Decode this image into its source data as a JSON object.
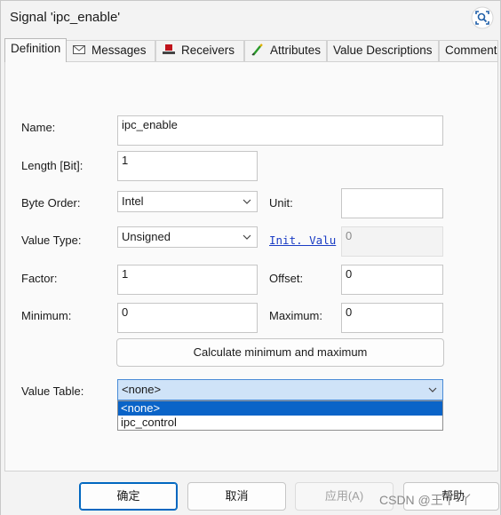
{
  "window": {
    "title": "Signal 'ipc_enable'"
  },
  "tabs": [
    {
      "label": "Definition",
      "icon": "none"
    },
    {
      "label": "Messages",
      "icon": "envelope-icon"
    },
    {
      "label": "Receivers",
      "icon": "receiver-icon"
    },
    {
      "label": "Attributes",
      "icon": "attributes-icon"
    },
    {
      "label": "Value Descriptions",
      "icon": "none"
    },
    {
      "label": "Comment",
      "icon": "none"
    }
  ],
  "form": {
    "name_label": "Name:",
    "name_value": "ipc_enable",
    "length_label": "Length [Bit]:",
    "length_value": "1",
    "byte_order_label": "Byte Order:",
    "byte_order_value": "Intel",
    "unit_label": "Unit:",
    "unit_value": "",
    "value_type_label": "Value Type:",
    "value_type_value": "Unsigned",
    "init_value_link": "Init. Valu",
    "init_value_value": "0",
    "factor_label": "Factor:",
    "factor_value": "1",
    "offset_label": "Offset:",
    "offset_value": "0",
    "minimum_label": "Minimum:",
    "minimum_value": "0",
    "maximum_label": "Maximum:",
    "maximum_value": "0",
    "calc_button": "Calculate minimum and maximum",
    "value_table_label": "Value Table:",
    "value_table_value": "<none>",
    "value_table_options": [
      "<none>",
      "ipc_control"
    ]
  },
  "footer": {
    "ok": "确定",
    "cancel": "取消",
    "apply": "应用(A)",
    "help": "帮助"
  },
  "watermark": "CSDN @王丫-丫",
  "colors": {
    "accent": "#0067c0",
    "selection": "#0a64c8",
    "link": "#1a3cc4"
  }
}
